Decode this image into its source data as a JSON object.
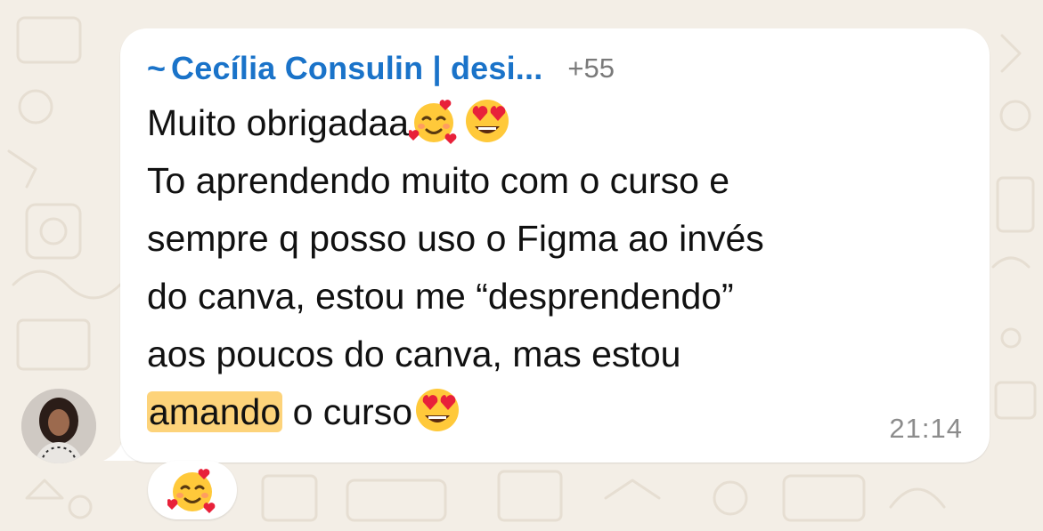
{
  "chat": {
    "sender_prefix": "~",
    "sender_name": "Cecília Consulin | desi...",
    "sender_phone": "+55",
    "time": "21:14",
    "lines": [
      "Muito obrigadaa",
      "To aprendendo muito com o curso e",
      "sempre q posso uso o Figma ao invés",
      "do canva, estou me “desprendendo”",
      "aos poucos do canva, mas estou"
    ],
    "last_line_highlight": "amando",
    "last_line_rest": " o curso",
    "emojis": [
      "smiling-face-with-hearts",
      "heart-eyes",
      "heart-eyes"
    ],
    "reaction": "smiling-face-with-hearts"
  },
  "colors": {
    "sender": "#1a73c9",
    "highlight": "#fdd37a",
    "wallpaper": "#f3eee6",
    "bubble": "#ffffff",
    "timestamp": "#8c8c8c"
  }
}
